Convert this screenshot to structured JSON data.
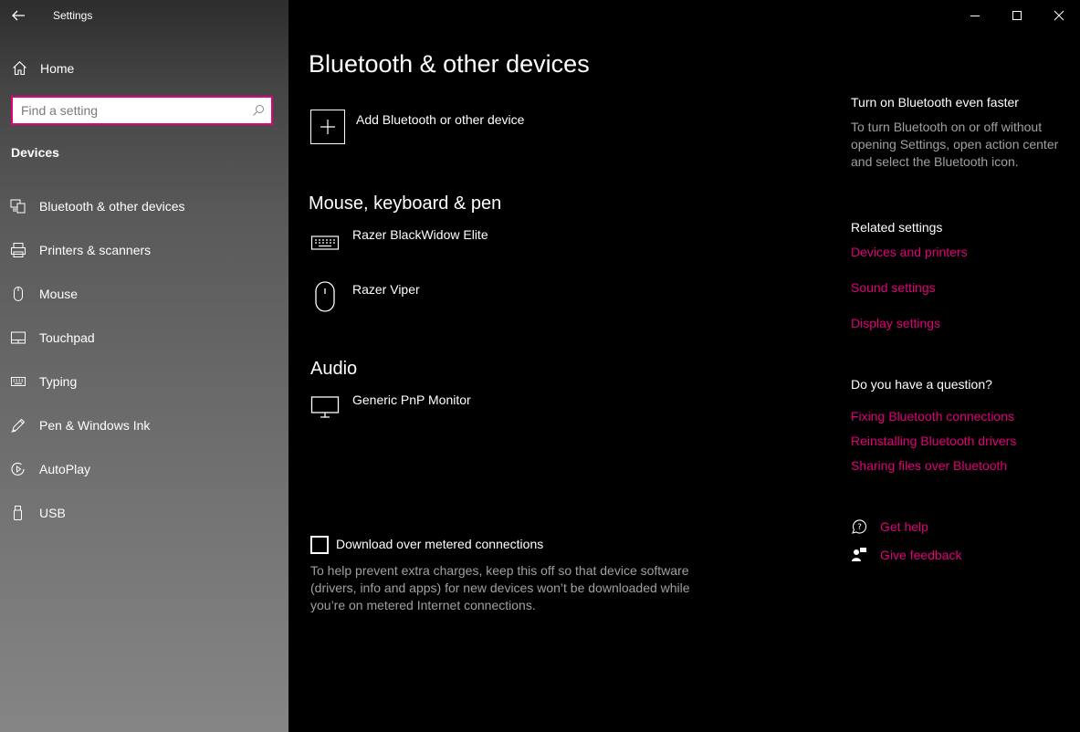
{
  "window": {
    "app_title": "Settings"
  },
  "sidebar": {
    "home_label": "Home",
    "search_placeholder": "Find a setting",
    "section_title": "Devices",
    "items": [
      {
        "label": "Bluetooth & other devices",
        "icon": "bluetooth-devices-icon"
      },
      {
        "label": "Printers & scanners",
        "icon": "printer-icon"
      },
      {
        "label": "Mouse",
        "icon": "mouse-icon"
      },
      {
        "label": "Touchpad",
        "icon": "touchpad-icon"
      },
      {
        "label": "Typing",
        "icon": "keyboard-icon"
      },
      {
        "label": "Pen & Windows Ink",
        "icon": "pen-icon"
      },
      {
        "label": "AutoPlay",
        "icon": "autoplay-icon"
      },
      {
        "label": "USB",
        "icon": "usb-icon"
      }
    ]
  },
  "main": {
    "title": "Bluetooth & other devices",
    "add_device_label": "Add Bluetooth or other device",
    "groups": [
      {
        "header": "Mouse, keyboard & pen",
        "devices": [
          {
            "name": "Razer BlackWidow Elite",
            "icon": "keyboard-icon"
          },
          {
            "name": "Razer Viper",
            "icon": "mouse-icon"
          }
        ]
      },
      {
        "header": "Audio",
        "devices": [
          {
            "name": "Generic PnP Monitor",
            "icon": "monitor-icon"
          }
        ]
      }
    ],
    "metered": {
      "label": "Download over metered connections",
      "checked": false,
      "help_text": "To help prevent extra charges, keep this off so that device software (drivers, info and apps) for new devices won’t be downloaded while you’re on metered Internet connections."
    }
  },
  "right_panel": {
    "tip_heading": "Turn on Bluetooth even faster",
    "tip_text": "To turn Bluetooth on or off without opening Settings, open action center and select the Bluetooth icon.",
    "related_heading": "Related settings",
    "related_links": [
      "Devices and printers",
      "Sound settings",
      "Display settings"
    ],
    "question_heading": "Do you have a question?",
    "question_links": [
      "Fixing Bluetooth connections",
      "Reinstalling Bluetooth drivers",
      "Sharing files over Bluetooth"
    ],
    "get_help": "Get help",
    "give_feedback": "Give feedback"
  },
  "colors": {
    "accent": "#e3007a",
    "background": "#000000",
    "secondary_text": "#a0a0a0"
  }
}
